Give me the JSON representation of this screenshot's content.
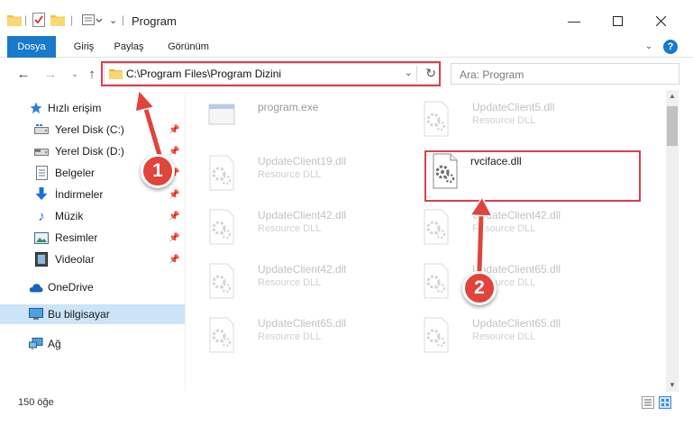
{
  "window": {
    "title": "Program"
  },
  "ribbon": {
    "tabs": [
      "Dosya",
      "Giriş",
      "Paylaş",
      "Görünüm"
    ]
  },
  "address": {
    "path": "C:\\Program Files\\Program Dizini"
  },
  "search": {
    "placeholder": "Ara: Program"
  },
  "sidebar": {
    "quick_access": "Hızlı erişim",
    "items": [
      {
        "label": "Yerel Disk (C:)",
        "icon": "disk-icon",
        "pinned": true
      },
      {
        "label": "Yerel Disk (D:)",
        "icon": "disk-icon",
        "pinned": true
      },
      {
        "label": "Belgeler",
        "icon": "document-icon",
        "pinned": true
      },
      {
        "label": "İndirmeler",
        "icon": "download-icon",
        "pinned": true
      },
      {
        "label": "Müzik",
        "icon": "music-icon",
        "pinned": true
      },
      {
        "label": "Resimler",
        "icon": "pictures-icon",
        "pinned": true
      },
      {
        "label": "Videolar",
        "icon": "videos-icon",
        "pinned": true
      }
    ],
    "onedrive": "OneDrive",
    "this_pc": "Bu bilgisayar",
    "network": "Ağ"
  },
  "files": [
    {
      "name": "program.exe",
      "type": ""
    },
    {
      "name": "UpdateClient5.dll",
      "type": "Resource DLL"
    },
    {
      "name": "UpdateClient19.dll",
      "type": "Resource DLL"
    },
    {
      "name": "rvciface.dll",
      "type": ""
    },
    {
      "name": "UpdateClient42.dll",
      "type": "Resource DLL"
    },
    {
      "name": "UpdateClient42.dll",
      "type": "Resource DLL"
    },
    {
      "name": "UpdateClient42.dll",
      "type": "Resource DLL"
    },
    {
      "name": "UpdateClient65.dll",
      "type": "Resource DLL"
    },
    {
      "name": "UpdateClient65.dll",
      "type": "Resource DLL"
    },
    {
      "name": "UpdateClient65.dll",
      "type": "Resource DLL"
    }
  ],
  "status": {
    "count": "150 öğe"
  },
  "annotations": {
    "step1": "1",
    "step2": "2"
  },
  "colors": {
    "accent": "#1979ca",
    "highlight": "#d94050",
    "selection": "#cce4f7"
  }
}
